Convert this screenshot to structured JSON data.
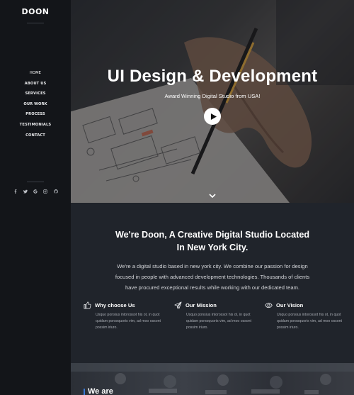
{
  "brand": {
    "logo": "DOON"
  },
  "nav": {
    "items": [
      "HOME",
      "ABOUT US",
      "SERVICES",
      "OUR WORK",
      "PROCESS",
      "TESTIMONIALS",
      "CONTACT"
    ]
  },
  "social": [
    "facebook-icon",
    "twitter-icon",
    "google-icon",
    "instagram-icon",
    "github-icon"
  ],
  "hero": {
    "title": "UI Design & Development",
    "subtitle": "Award Winning Digital Studio from USA!"
  },
  "about": {
    "title_line1": "We're Doon, A Creative Digital Studio Located",
    "title_line2": "In New York City.",
    "desc_line1": "We're a digital studio based in new york city. We combine our passion for design",
    "desc_line2": "focused in people with advanced development technologies. Thousands of clients",
    "desc_line3": "have procured exceptional results while working with our dedicated team."
  },
  "features": [
    {
      "title": "Why choose Us",
      "icon": "thumbs-up-icon",
      "text": "Usquo ponsius intorossot his ot, in quot quidam porsoquoris vim, ad moo ossont possim iriuro."
    },
    {
      "title": "Our Mission",
      "icon": "paper-plane-icon",
      "text": "Usquo ponsius intorossot his ot, in quot quidam porsoquoris vim, ad moo ossont possim iriuro."
    },
    {
      "title": "Our Vision",
      "icon": "eye-icon",
      "text": "Usquo ponsius intorossot his ot, in quot quidam porsoquoris vim, ad moo ossont possim iriuro."
    }
  ],
  "bottom": {
    "text": "We are"
  },
  "colors": {
    "sidebar": "#131519",
    "about_bg": "#20242b",
    "accent": "#3a78d6"
  }
}
